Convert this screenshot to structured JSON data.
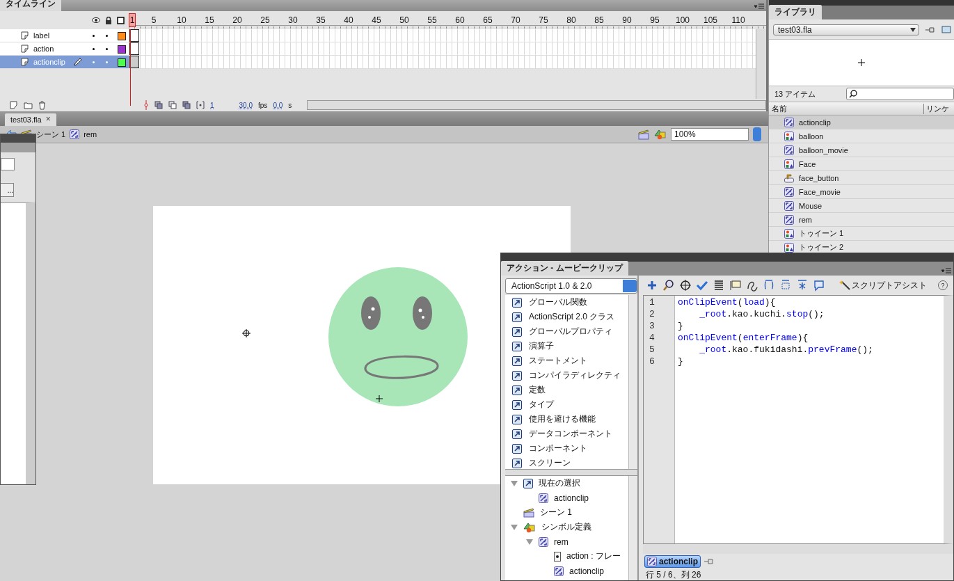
{
  "timeline": {
    "tab": "タイムライン",
    "frame_numbers": [
      {
        "label": "1",
        "current": true
      },
      {
        "label": "5",
        "current": false
      },
      {
        "label": "10",
        "current": false
      },
      {
        "label": "15",
        "current": false
      },
      {
        "label": "20",
        "current": false
      },
      {
        "label": "25",
        "current": false
      },
      {
        "label": "30",
        "current": false
      },
      {
        "label": "35",
        "current": false
      },
      {
        "label": "40",
        "current": false
      },
      {
        "label": "45",
        "current": false
      },
      {
        "label": "50",
        "current": false
      },
      {
        "label": "55",
        "current": false
      },
      {
        "label": "60",
        "current": false
      },
      {
        "label": "65",
        "current": false
      },
      {
        "label": "70",
        "current": false
      },
      {
        "label": "75",
        "current": false
      },
      {
        "label": "80",
        "current": false
      },
      {
        "label": "85",
        "current": false
      },
      {
        "label": "90",
        "current": false
      },
      {
        "label": "95",
        "current": false
      },
      {
        "label": "100",
        "current": false
      },
      {
        "label": "105",
        "current": false
      },
      {
        "label": "110",
        "current": false
      }
    ],
    "layers": [
      {
        "name": "label",
        "color": "#ff8c1a",
        "selected": false,
        "editing": false
      },
      {
        "name": "action",
        "color": "#9933cc",
        "selected": false,
        "editing": false
      },
      {
        "name": "actionclip",
        "color": "#4cff4c",
        "selected": true,
        "editing": true
      }
    ],
    "footer": {
      "current_frame": "1",
      "fps": "30.0",
      "fps_unit": "fps",
      "time": "0.0",
      "time_unit": "s"
    }
  },
  "library": {
    "tab": "ライブラリ",
    "document": "test03.fla",
    "count": "13 アイテム",
    "columns": [
      "名前",
      "リンケ"
    ],
    "items": [
      {
        "name": "actionclip",
        "kind": "movieclip",
        "selected": true
      },
      {
        "name": "balloon",
        "kind": "graphic",
        "selected": false
      },
      {
        "name": "balloon_movie",
        "kind": "movieclip",
        "selected": false
      },
      {
        "name": "Face",
        "kind": "graphic",
        "selected": false
      },
      {
        "name": "face_button",
        "kind": "button",
        "selected": false
      },
      {
        "name": "Face_movie",
        "kind": "movieclip",
        "selected": false
      },
      {
        "name": "Mouse",
        "kind": "movieclip",
        "selected": false
      },
      {
        "name": "rem",
        "kind": "movieclip",
        "selected": false
      },
      {
        "name": "トゥイーン 1",
        "kind": "graphic",
        "selected": false
      },
      {
        "name": "トゥイーン 2",
        "kind": "graphic",
        "selected": false
      }
    ]
  },
  "document": {
    "tab": "test03.fla",
    "close": "×",
    "breadcrumb": [
      "シーン 1",
      "rem"
    ],
    "zoom": "100%"
  },
  "side_panel": {
    "button": "..."
  },
  "actions": {
    "title": "アクション - ムービークリップ",
    "language": "ActionScript 1.0 & 2.0",
    "toolbox": [
      "グローバル関数",
      "ActionScript 2.0 クラス",
      "グローバルプロパティ",
      "演算子",
      "ステートメント",
      "コンパイラディレクティ",
      "定数",
      "タイプ",
      "使用を避ける機能",
      "データコンポーネント",
      "コンポーネント",
      "スクリーン"
    ],
    "tree": [
      {
        "label": "現在の選択",
        "kind": "selection",
        "expanded": true,
        "children": [
          {
            "label": "actionclip",
            "kind": "movieclip"
          }
        ]
      },
      {
        "label": "シーン 1",
        "kind": "scene"
      },
      {
        "label": "シンボル定義",
        "kind": "symbols",
        "expanded": true,
        "children": [
          {
            "label": "rem",
            "kind": "movieclip",
            "expanded": true,
            "children": [
              {
                "label": "action : フレー",
                "kind": "frame"
              },
              {
                "label": "actionclip",
                "kind": "movieclip"
              }
            ]
          }
        ]
      }
    ],
    "script_assist": "スクリプトアシスト",
    "help": "?",
    "code": [
      {
        "number": "1",
        "indented": false,
        "tokens": [
          {
            "text": "onClipEvent",
            "kind": "keyword"
          },
          {
            "text": "(",
            "kind": "plain"
          },
          {
            "text": "load",
            "kind": "keyword"
          },
          {
            "text": "){",
            "kind": "plain"
          }
        ]
      },
      {
        "number": "2",
        "indented": true,
        "tokens": [
          {
            "text": "_root",
            "kind": "keyword"
          },
          {
            "text": ".kao.kuchi.",
            "kind": "plain"
          },
          {
            "text": "stop",
            "kind": "keyword"
          },
          {
            "text": "();",
            "kind": "plain"
          }
        ]
      },
      {
        "number": "3",
        "indented": false,
        "tokens": [
          {
            "text": "}",
            "kind": "plain"
          }
        ]
      },
      {
        "number": "4",
        "indented": false,
        "tokens": [
          {
            "text": "onClipEvent",
            "kind": "keyword"
          },
          {
            "text": "(",
            "kind": "plain"
          },
          {
            "text": "enterFrame",
            "kind": "keyword"
          },
          {
            "text": "){",
            "kind": "plain"
          }
        ]
      },
      {
        "number": "5",
        "indented": true,
        "tokens": [
          {
            "text": "_root",
            "kind": "keyword"
          },
          {
            "text": ".kao.fukidashi.",
            "kind": "plain"
          },
          {
            "text": "prevFrame",
            "kind": "keyword"
          },
          {
            "text": "();",
            "kind": "plain"
          }
        ]
      },
      {
        "number": "6",
        "indented": false,
        "tokens": [
          {
            "text": "}",
            "kind": "plain"
          }
        ]
      }
    ],
    "script_tab": "actionclip",
    "status": "行 5 / 6、列 26"
  }
}
